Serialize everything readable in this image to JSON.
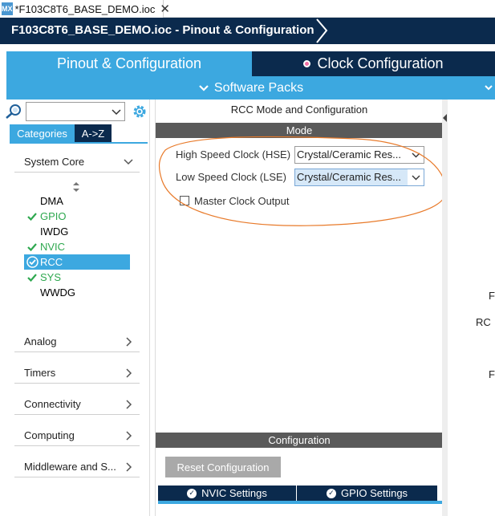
{
  "tab": {
    "logo": "MX",
    "title": "*F103C8T6_BASE_DEMO.ioc",
    "close": "✕"
  },
  "breadcrumb": {
    "label": "F103C8T6_BASE_DEMO.ioc - Pinout & Configuration"
  },
  "main_tabs": {
    "pinout": "Pinout & Configuration",
    "clock": "Clock Configuration",
    "software_packs": "Software Packs"
  },
  "left": {
    "search_value": "",
    "tabs": {
      "categories": "Categories",
      "atoz": "A->Z"
    },
    "sections": {
      "system_core": "System Core",
      "analog": "Analog",
      "timers": "Timers",
      "connectivity": "Connectivity",
      "computing": "Computing",
      "middleware": "Middleware and S..."
    },
    "peripherals": [
      {
        "label": "DMA",
        "status": "none"
      },
      {
        "label": "GPIO",
        "status": "ok"
      },
      {
        "label": "IWDG",
        "status": "none"
      },
      {
        "label": "NVIC",
        "status": "ok"
      },
      {
        "label": "RCC",
        "status": "selected"
      },
      {
        "label": "SYS",
        "status": "ok"
      },
      {
        "label": "WWDG",
        "status": "none"
      }
    ]
  },
  "middle": {
    "title": "RCC Mode and Configuration",
    "mode_header": "Mode",
    "hse": {
      "label": "High Speed Clock (HSE)",
      "value": "Crystal/Ceramic Res..."
    },
    "lse": {
      "label": "Low Speed Clock (LSE)",
      "value": "Crystal/Ceramic Res..."
    },
    "mco": {
      "label": "Master Clock Output",
      "checked": false
    },
    "config_header": "Configuration",
    "reset_button": "Reset Configuration",
    "settings_tabs": [
      "NVIC Settings",
      "GPIO Settings"
    ]
  },
  "right": {
    "fragments": [
      "F",
      "RC",
      "F"
    ]
  },
  "colors": {
    "navy": "#0b2a4d",
    "accent_blue": "#3ca8e0",
    "ok_green": "#2ea84f",
    "annotation_orange": "#e87a2a",
    "gray_header": "#5a5a5a"
  }
}
